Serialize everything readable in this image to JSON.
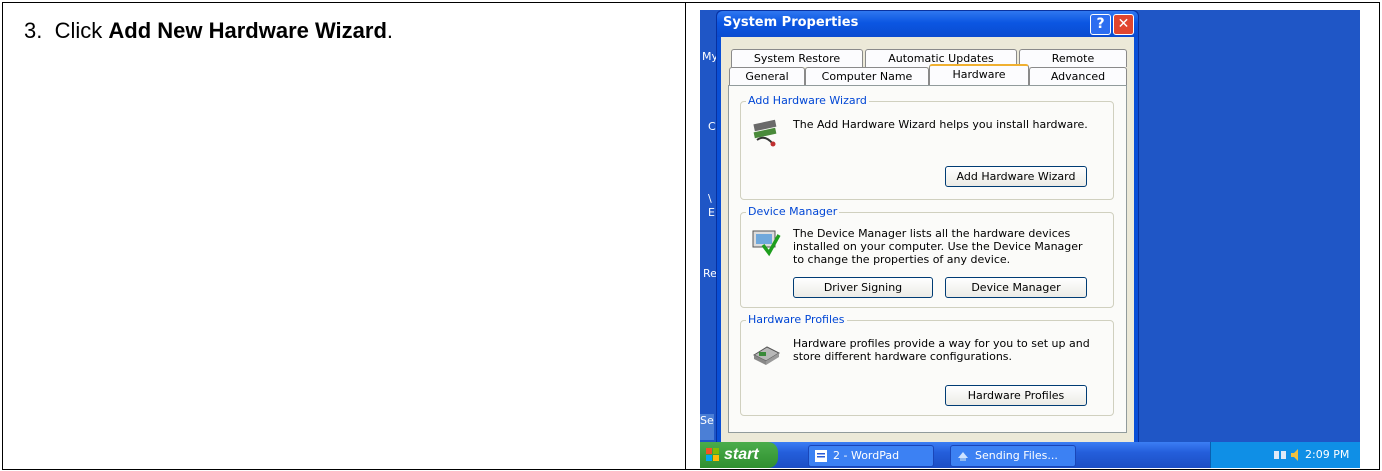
{
  "instruction": {
    "number": "3.",
    "prefix": "Click ",
    "target": "Add New Hardware Wizard",
    "suffix": "."
  },
  "desktop": {
    "labels": [
      "My",
      "C",
      "\\",
      "E",
      "Re",
      "Se"
    ]
  },
  "dialog": {
    "title": "System Properties",
    "help_glyph": "?",
    "close_glyph": "✕",
    "tabs_back": [
      "System Restore",
      "Automatic Updates",
      "Remote"
    ],
    "tabs_front": [
      "General",
      "Computer Name",
      "Hardware",
      "Advanced"
    ],
    "active_tab": "Hardware",
    "groups": {
      "add_hw": {
        "legend": "Add Hardware Wizard",
        "text": "The Add Hardware Wizard helps you install hardware.",
        "button": "Add Hardware Wizard",
        "icon": "hardware-wizard-icon"
      },
      "device_mgr": {
        "legend": "Device Manager",
        "text": "The Device Manager lists all the hardware devices installed on your computer. Use the Device Manager to change the properties of any device.",
        "buttons": [
          "Driver Signing",
          "Device Manager"
        ],
        "icon": "device-manager-icon"
      },
      "hw_profiles": {
        "legend": "Hardware Profiles",
        "text": "Hardware profiles provide a way for you to set up and store different hardware configurations.",
        "button": "Hardware Profiles",
        "icon": "hardware-profiles-icon"
      }
    }
  },
  "taskbar": {
    "start": "start",
    "tasks": [
      "2 - WordPad",
      "Sending Files..."
    ],
    "clock": "2:09 PM"
  },
  "colors": {
    "xp_blue": "#0a4fd6",
    "desktop": "#1f56c6",
    "start_green": "#3a9a3a",
    "dialog_face": "#ece9d8"
  }
}
